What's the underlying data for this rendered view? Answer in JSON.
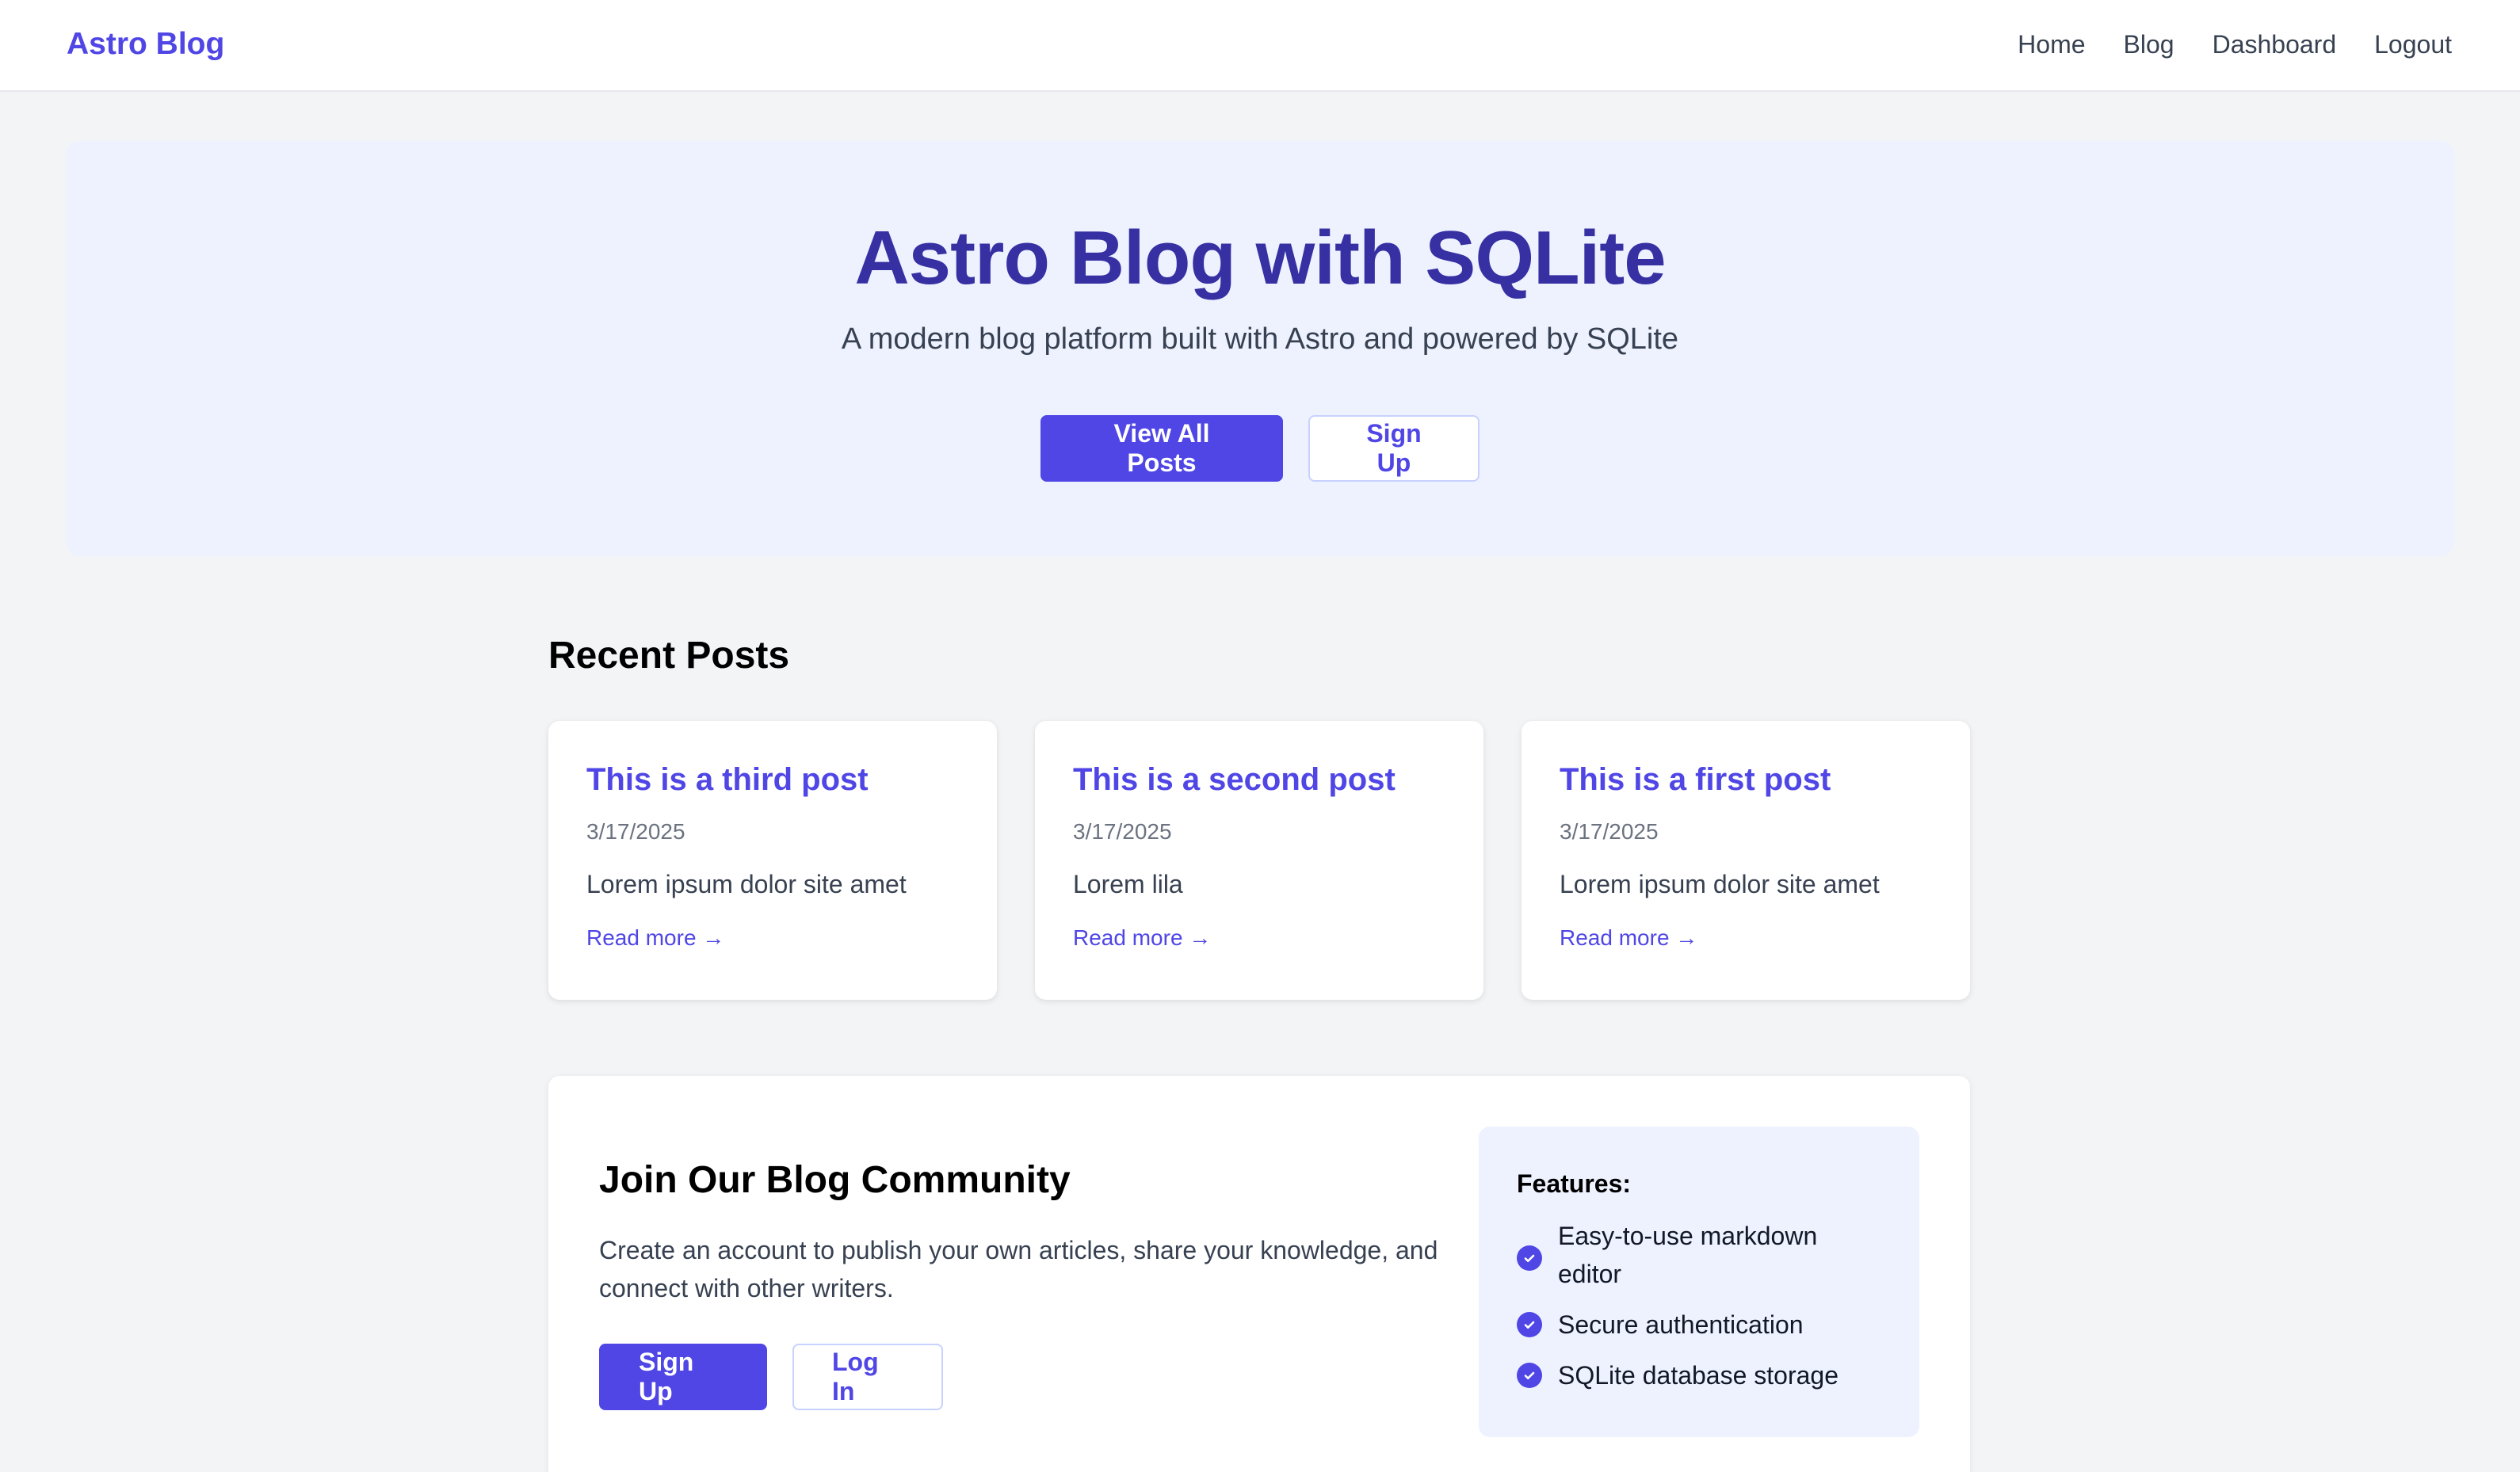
{
  "navbar": {
    "brand": "Astro Blog",
    "links": [
      "Home",
      "Blog",
      "Dashboard",
      "Logout"
    ]
  },
  "hero": {
    "title": "Astro Blog with SQLite",
    "subtitle": "A modern blog platform built with Astro and powered by SQLite",
    "primary_button": "View All Posts",
    "secondary_button": "Sign Up"
  },
  "recent": {
    "title": "Recent Posts",
    "posts": [
      {
        "title": "This is a third post",
        "date": "3/17/2025",
        "excerpt": "Lorem ipsum dolor site amet",
        "link": "Read more →"
      },
      {
        "title": "This is a second post",
        "date": "3/17/2025",
        "excerpt": "Lorem lila",
        "link": "Read more →"
      },
      {
        "title": "This is a first post",
        "date": "3/17/2025",
        "excerpt": "Lorem ipsum dolor site amet",
        "link": "Read more →"
      }
    ]
  },
  "community": {
    "title": "Join Our Blog Community",
    "description": "Create an account to publish your own articles, share your knowledge, and connect with other writers.",
    "signup_button": "Sign Up",
    "login_button": "Log In",
    "features_title": "Features:",
    "features": [
      "Easy-to-use markdown editor",
      "Secure authentication",
      "SQLite database storage"
    ]
  },
  "colors": {
    "accent": "#4f46e5",
    "hero_bg": "#eef2ff",
    "hero_title": "#3730a3",
    "page_bg": "#f3f4f6"
  }
}
